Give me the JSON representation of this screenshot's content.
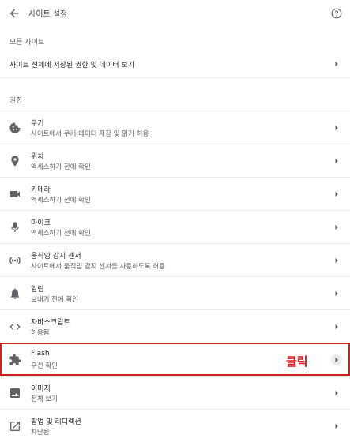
{
  "header": {
    "title": "사이트 설정",
    "back_icon": "arrow-back-icon",
    "help_icon": "help-circle-icon"
  },
  "all_sites": {
    "section_label": "모든 사이트",
    "row_title": "사이트 전체에 저장된 권한 및 데이터 보기"
  },
  "permissions": {
    "section_label": "권한",
    "items": [
      {
        "icon": "cookie-icon",
        "title": "쿠키",
        "subtitle": "사이트에서 쿠키 데이터 저장 및 읽기 허용"
      },
      {
        "icon": "location-pin-icon",
        "title": "위치",
        "subtitle": "액세스하기 전에 확인"
      },
      {
        "icon": "camera-icon",
        "title": "카메라",
        "subtitle": "액세스하기 전에 확인"
      },
      {
        "icon": "microphone-icon",
        "title": "마이크",
        "subtitle": "액세스하기 전에 확인"
      },
      {
        "icon": "motion-sensor-icon",
        "title": "움직임 감지 센서",
        "subtitle": "사이트에서 움직임 감지 센서를 사용하도록 허용"
      },
      {
        "icon": "bell-icon",
        "title": "알림",
        "subtitle": "보내기 전에 확인"
      },
      {
        "icon": "code-icon",
        "title": "자바스크립트",
        "subtitle": "허용됨"
      },
      {
        "icon": "puzzle-icon",
        "title": "Flash",
        "subtitle": "우선 확인"
      },
      {
        "icon": "image-icon",
        "title": "이미지",
        "subtitle": "전체 보기"
      },
      {
        "icon": "open-external-icon",
        "title": "팝업 및 리디렉션",
        "subtitle": "차단됨"
      }
    ]
  },
  "annotation": {
    "click_label": "클릭",
    "color": "#d31c1c"
  },
  "colors": {
    "text_primary": "#202124",
    "text_secondary": "#5f6368",
    "divider": "#e8eaed",
    "icon": "#5f6368"
  }
}
